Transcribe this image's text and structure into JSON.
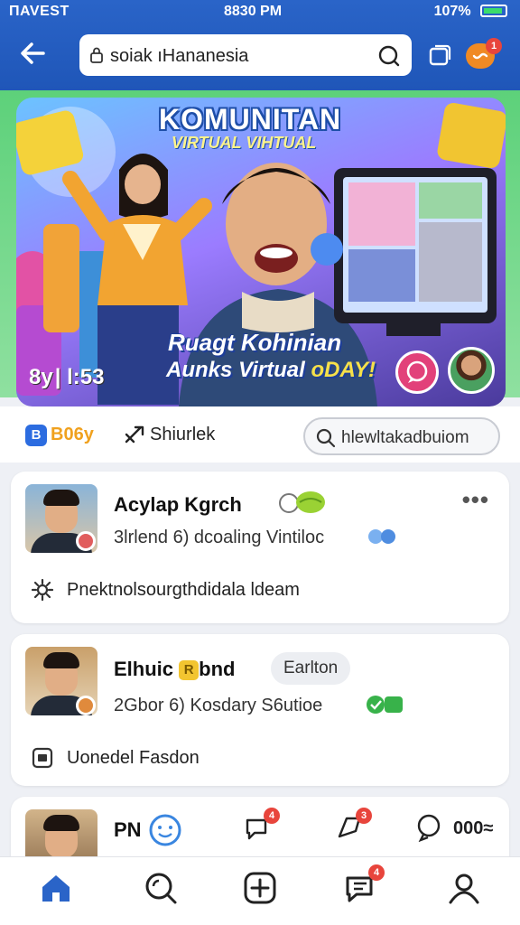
{
  "status_bar": {
    "carrier": "ΠAVEST",
    "time": "8830 PM",
    "battery": "107%"
  },
  "top_bar": {
    "search_value": "soiak ıHananesia"
  },
  "hero": {
    "title": "KOMUNITAN",
    "subtitle": "VIRTUAL VIHTUAL",
    "caption_line1": "Ruagt Kohinian",
    "caption_line2_a": "Aunks Virtual ",
    "caption_line2_b": "oDAY!",
    "timer": "8y | l:53"
  },
  "info_row": {
    "brand": "B06y",
    "share_label": "Shiurlek",
    "search_pill": "hlewltakadbuiom"
  },
  "posts": [
    {
      "name": "Acylap Kgrch",
      "meta": "3lrlend 6) dcoaling  Vintiloc",
      "desc": "Pnektnolsourgthdidala ldeam"
    },
    {
      "name": "Elhuic",
      "name_badge": "R",
      "name_tail": "bnd",
      "tag": "Earlton",
      "meta": "2Gbor 6) Kosdary  S6utioe",
      "desc": "Uonedel Fasdon"
    },
    {
      "name": "PN",
      "reply_count": "000",
      "reply_suffix": "≈"
    }
  ],
  "badges": {
    "top_chat": "1",
    "comment": "4",
    "share": "3",
    "messages": "4"
  },
  "colors": {
    "brand_blue": "#2a64c8",
    "accent_orange": "#f08a24",
    "badge_red": "#e8453c",
    "online_green": "#33b24a"
  }
}
